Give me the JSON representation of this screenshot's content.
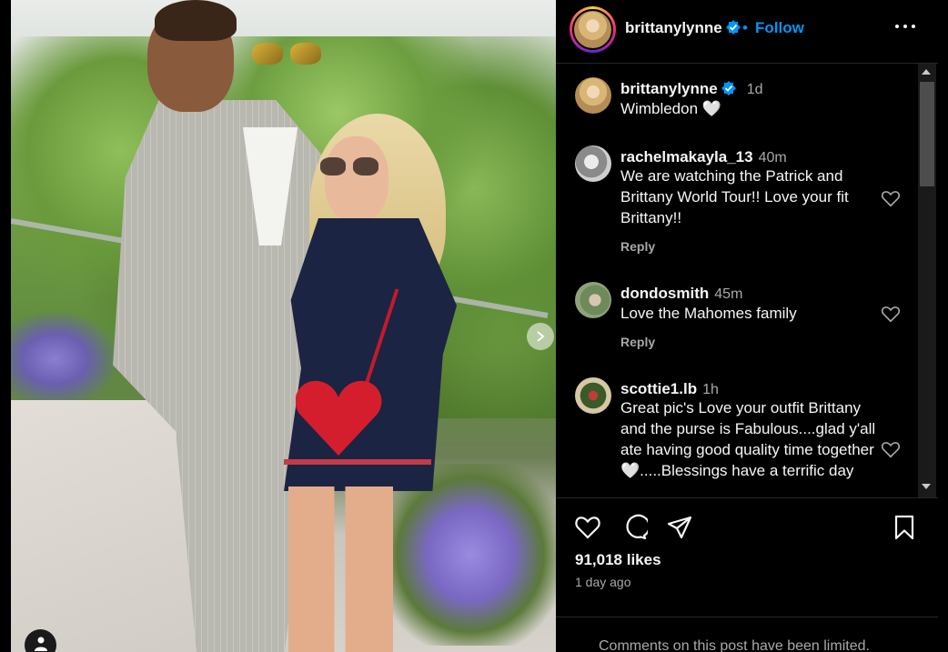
{
  "post": {
    "author": "brittanylynne",
    "follow_label": "Follow",
    "separator": "•",
    "caption_time": "1d",
    "caption": "Wimbledon 🤍",
    "likes": "91,018 likes",
    "posted": "1 day ago",
    "comments_limited": "Comments on this post have been limited."
  },
  "comments": [
    {
      "user": "rachelmakayla_13",
      "time": "40m",
      "text": "We are watching the Patrick and Brittany World Tour!! Love your fit Brittany!!",
      "reply": "Reply"
    },
    {
      "user": "dondosmith",
      "time": "45m",
      "text": "Love the Mahomes family",
      "reply": "Reply"
    },
    {
      "user": "scottie1.lb",
      "time": "1h",
      "text": "Great pic's Love your outfit Brittany and the purse is Fabulous....glad y'all ate having good quality time together 🤍.....Blessings have a terrific day",
      "reply": ""
    }
  ],
  "icons": {
    "more": "more-options-icon",
    "verified": "verified-badge-icon",
    "like": "heart-icon",
    "comment": "comment-icon",
    "share": "share-icon",
    "save": "bookmark-icon",
    "next": "chevron-right-icon",
    "user_tag": "user-tag-icon"
  },
  "colors": {
    "accent": "#0095f6",
    "verified": "#0095f6",
    "background": "#000000",
    "muted": "#a8a8a8"
  }
}
